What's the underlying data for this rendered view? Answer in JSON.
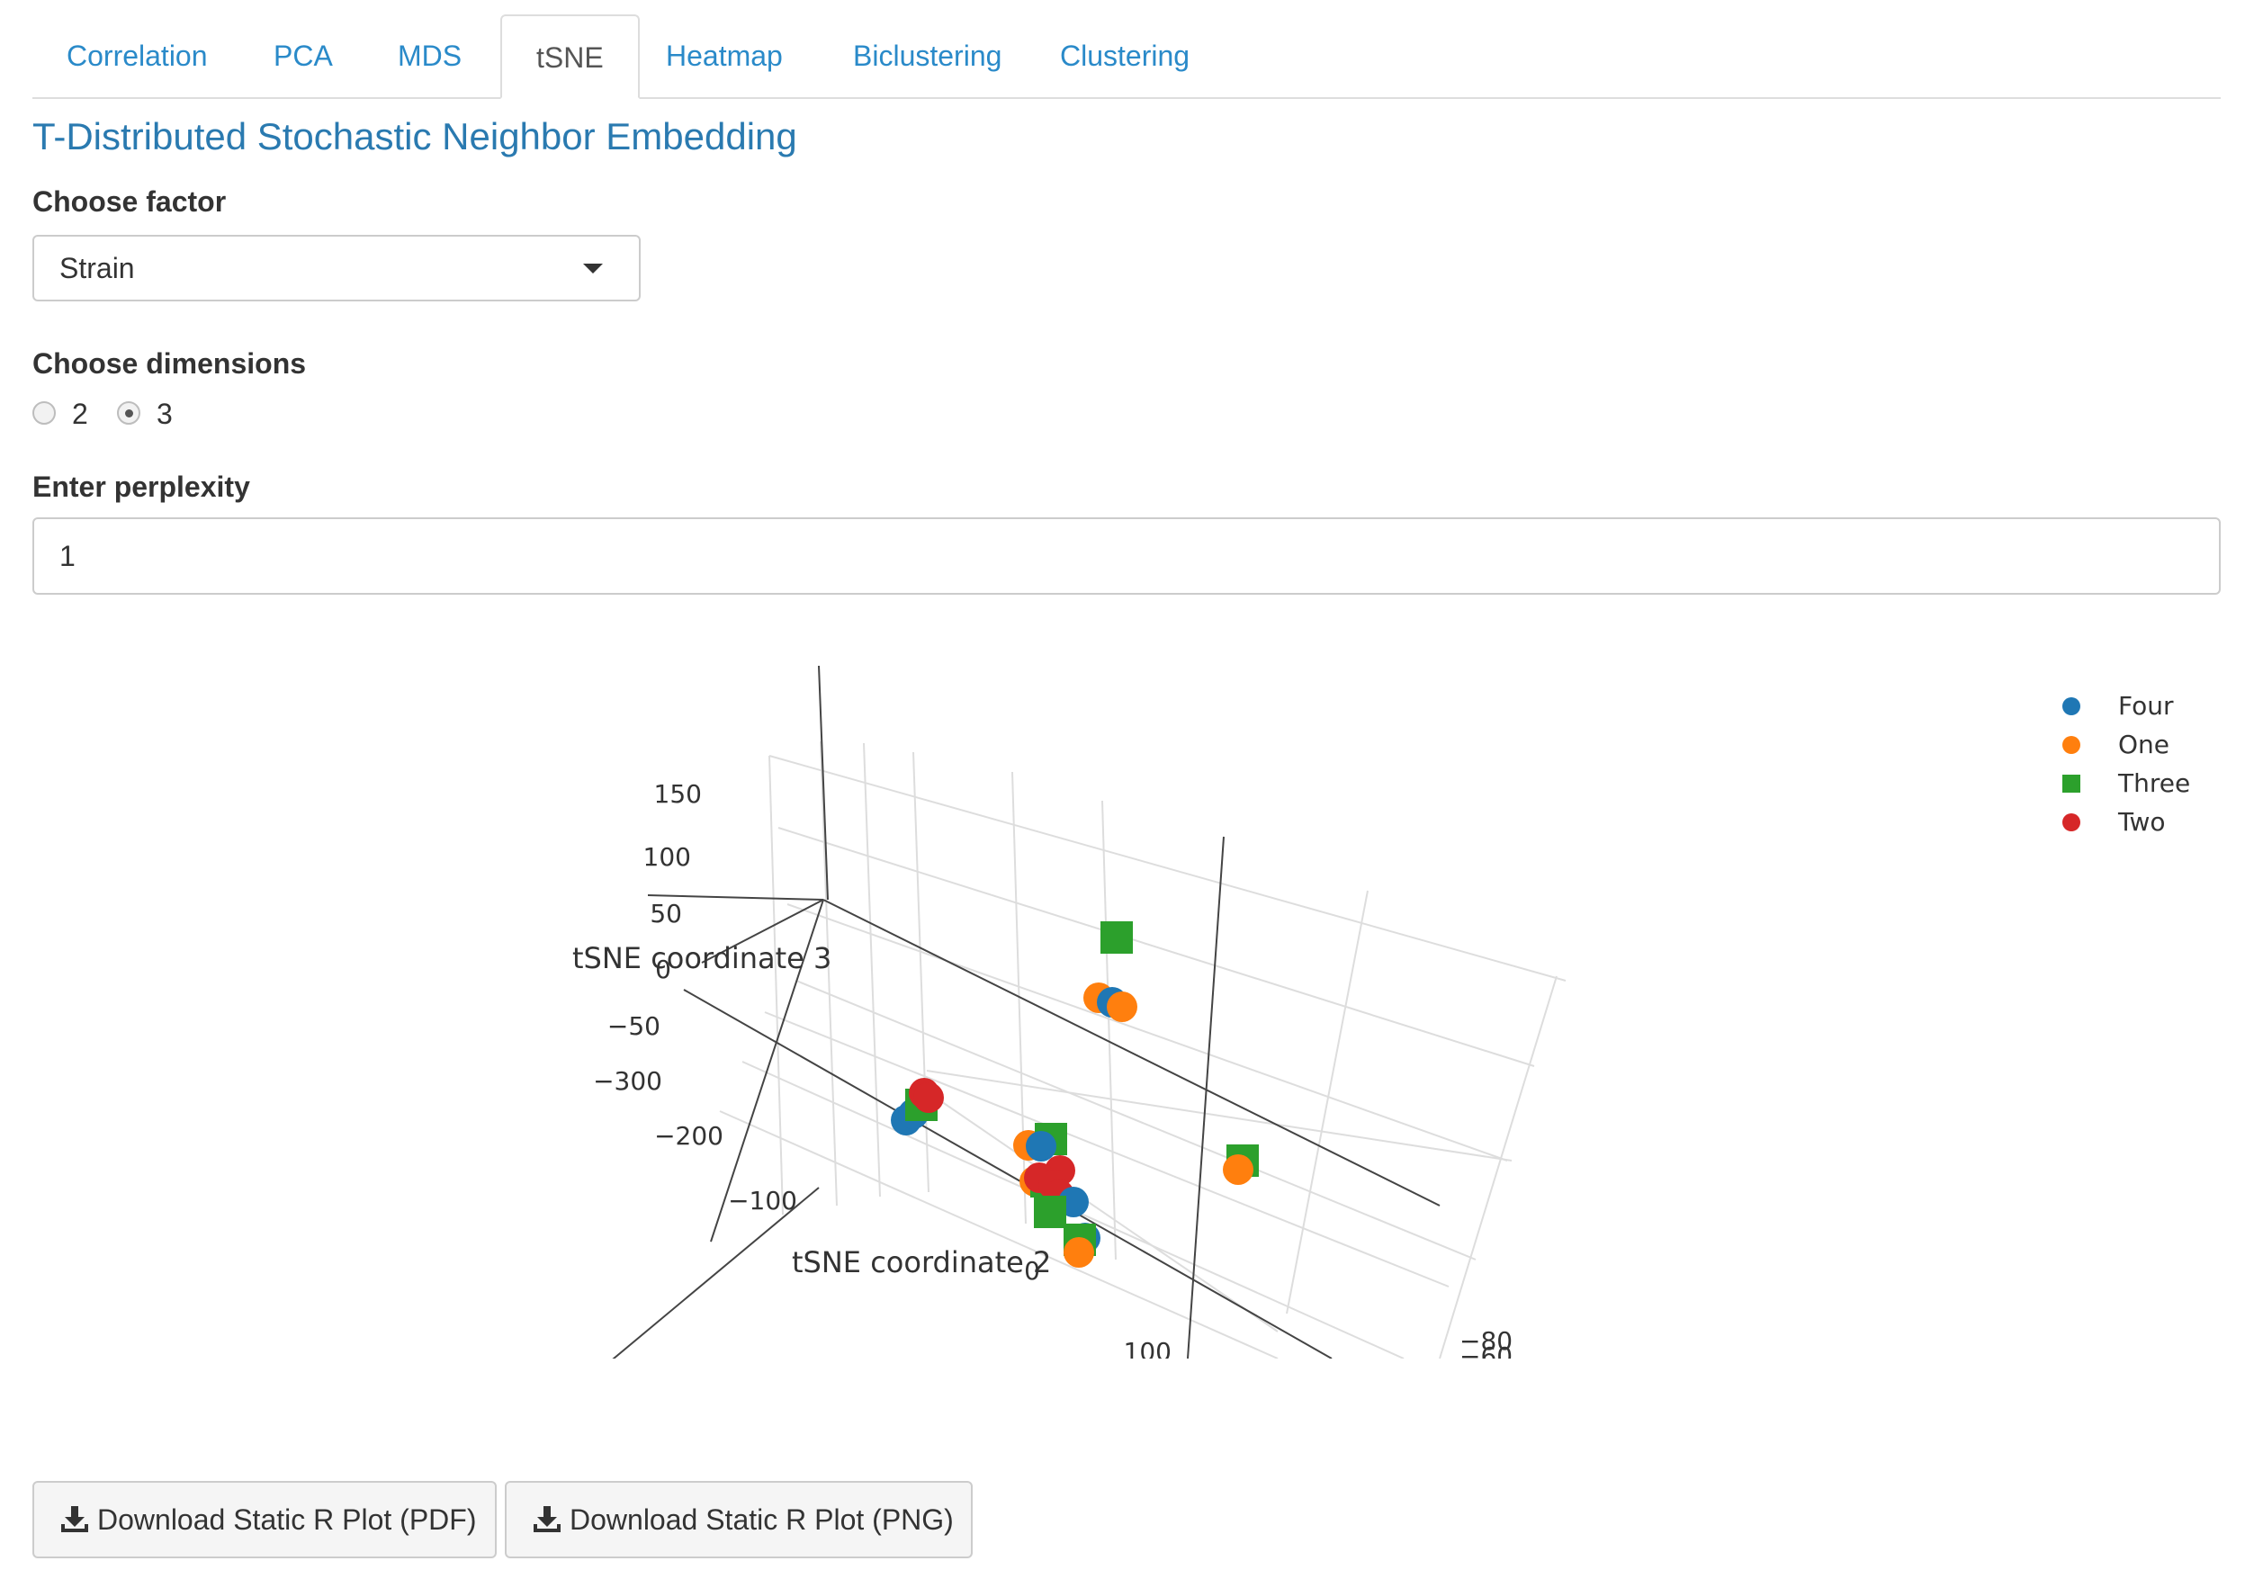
{
  "tabs": [
    {
      "label": "Correlation",
      "active": false
    },
    {
      "label": "PCA",
      "active": false
    },
    {
      "label": "MDS",
      "active": false
    },
    {
      "label": "tSNE",
      "active": true
    },
    {
      "label": "Heatmap",
      "active": false
    },
    {
      "label": "Biclustering",
      "active": false
    },
    {
      "label": "Clustering",
      "active": false
    }
  ],
  "page_title": "T-Distributed Stochastic Neighbor Embedding",
  "factor": {
    "label": "Choose factor",
    "selected": "Strain"
  },
  "dimensions": {
    "label": "Choose dimensions",
    "options": [
      "2",
      "3"
    ],
    "selected": "3"
  },
  "perplexity": {
    "label": "Enter perplexity",
    "value": "1"
  },
  "legend": {
    "items": [
      {
        "name": "Four",
        "color": "#1f77b4",
        "marker": "circle"
      },
      {
        "name": "One",
        "color": "#ff7f0e",
        "marker": "circle"
      },
      {
        "name": "Three",
        "color": "#2ca02c",
        "marker": "square"
      },
      {
        "name": "Two",
        "color": "#d62728",
        "marker": "circle"
      }
    ],
    "placement": "top-right"
  },
  "chart_data": {
    "type": "scatter",
    "projection": "3d",
    "axes": {
      "x": {
        "title": "",
        "visible_ticks": [
          "−80",
          "−60"
        ]
      },
      "y": {
        "title": "tSNE coordinate 2",
        "visible_ticks": [
          "−300",
          "−200",
          "−100",
          "0",
          "100"
        ]
      },
      "z": {
        "title": "tSNE coordinate 3",
        "visible_ticks": [
          "150",
          "100",
          "50",
          "0",
          "−50"
        ]
      }
    },
    "grid": true,
    "series": [
      {
        "name": "Four",
        "color": "#1f77b4",
        "marker": "circle"
      },
      {
        "name": "One",
        "color": "#ff7f0e",
        "marker": "circle"
      },
      {
        "name": "Three",
        "color": "#2ca02c",
        "marker": "square"
      },
      {
        "name": "Two",
        "color": "#d62728",
        "marker": "circle"
      }
    ]
  },
  "downloads": {
    "pdf_label": "Download Static R Plot (PDF)",
    "png_label": "Download Static R Plot (PNG)"
  }
}
